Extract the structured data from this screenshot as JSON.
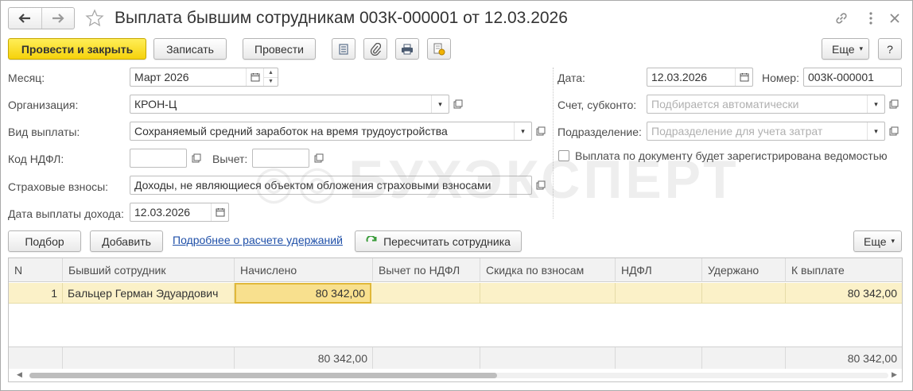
{
  "window": {
    "title": "Выплата бывшим сотрудникам 003К-000001 от 12.03.2026"
  },
  "toolbar": {
    "post_close": "Провести и закрыть",
    "save": "Записать",
    "post": "Провести",
    "more": "Еще",
    "help": "?"
  },
  "form": {
    "month_label": "Месяц:",
    "month_value": "Март 2026",
    "org_label": "Организация:",
    "org_value": "КРОН-Ц",
    "payment_type_label": "Вид выплаты:",
    "payment_type_value": "Сохраняемый средний заработок на время трудоустройства",
    "ndfl_code_label": "Код НДФЛ:",
    "ndfl_code_value": "",
    "deduction_label": "Вычет:",
    "deduction_value": "",
    "insurance_label": "Страховые взносы:",
    "insurance_value": "Доходы, не являющиеся объектом обложения страховыми взносами",
    "income_date_label": "Дата выплаты дохода:",
    "income_date_value": "12.03.2026",
    "date_label": "Дата:",
    "date_value": "12.03.2026",
    "number_label": "Номер:",
    "number_value": "003К-000001",
    "account_label": "Счет, субконто:",
    "account_placeholder": "Подбирается автоматически",
    "division_label": "Подразделение:",
    "division_placeholder": "Подразделение для учета затрат",
    "statement_checkbox_label": "Выплата по документу будет зарегистрирована ведомостью",
    "statement_checked": false
  },
  "watermark": "БУХЭКСПЕРТ",
  "table_toolbar": {
    "pick": "Подбор",
    "add": "Добавить",
    "details_link": "Подробнее о расчете удержаний",
    "recalc": "Пересчитать сотрудника",
    "more": "Еще"
  },
  "table": {
    "columns": [
      "N",
      "Бывший сотрудник",
      "Начислено",
      "Вычет по НДФЛ",
      "Скидка по взносам",
      "НДФЛ",
      "Удержано",
      "К выплате"
    ],
    "rows": [
      {
        "n": "1",
        "employee": "Бальцер Герман Эдуардович",
        "accrued": "80 342,00",
        "ndfl_deduction": "",
        "insurance_discount": "",
        "ndfl": "",
        "withheld": "",
        "to_pay": "80 342,00"
      }
    ],
    "totals": {
      "accrued": "80 342,00",
      "to_pay": "80 342,00"
    }
  },
  "colors": {
    "primary_button": "#f5d20b",
    "selected_row": "#fbf1c8",
    "link": "#1e4fa8"
  }
}
